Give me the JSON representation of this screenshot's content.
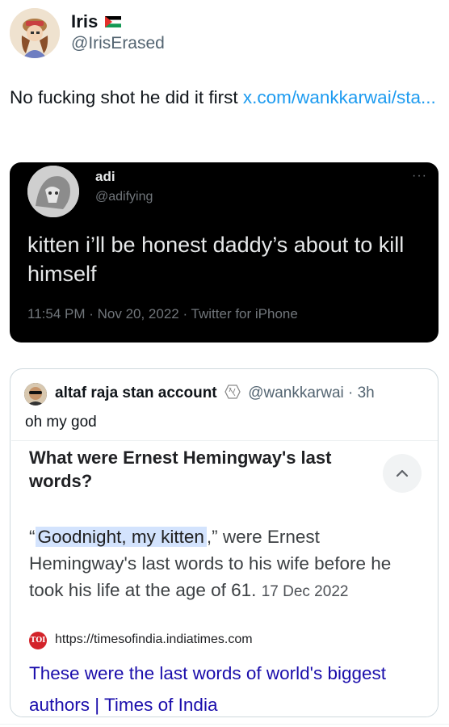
{
  "author": {
    "name": "Iris",
    "handle": "@IrisErased",
    "flag_icon": "palestine-flag-emoji"
  },
  "tweet": {
    "text": "No fucking shot he did it first ",
    "link_text": "x.com/wankkarwai/​sta..."
  },
  "screenshot": {
    "name": "adi",
    "handle": "@adifying",
    "text": "kitten i’ll be honest daddy’s about to kill himself",
    "meta": "11:54 PM · Nov 20, 2022 · Twitter for iPhone",
    "more_icon": "···"
  },
  "quoted": {
    "name": "altaf raja stan account",
    "badge_icon": "hexagon-emoji",
    "handle_time": "@wankkarwai · 3h",
    "text": "oh my god",
    "google": {
      "question": "What were Ernest Hemingway's last words?",
      "answer_open_quote": "“",
      "answer_highlight": "Goodnight, my kitten",
      "answer_rest": ",” were Ernest Hemingway's last words to his wife before he took his life at the age of 61.",
      "answer_date": "17 Dec 2022",
      "logo_text": "TOI",
      "source_url": "https://timesofindia.indiatimes.com",
      "result_title": "These were the last words of world's biggest authors | Times of India",
      "collapse_icon": "chevron-up-icon"
    }
  },
  "colors": {
    "link": "#1d9bf0",
    "dark_card": "#000000",
    "google_link": "#1a0dab",
    "highlight": "#d3e3fd",
    "toi_red": "#d3232a"
  }
}
